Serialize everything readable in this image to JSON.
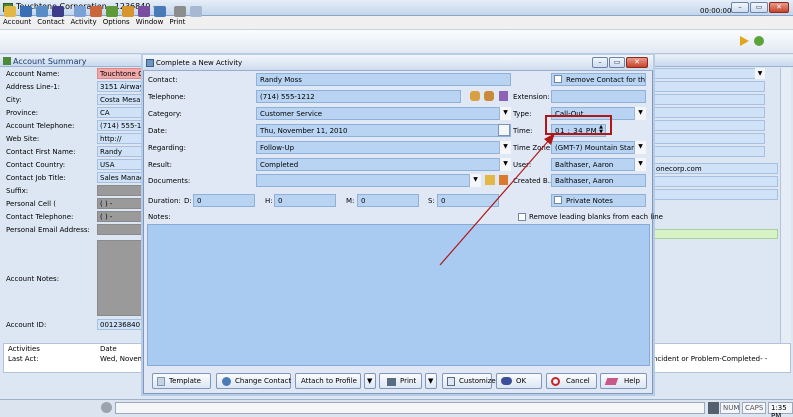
{
  "window": {
    "title": "Touchtone Corporation - 1236840 -",
    "minimize": "–",
    "restore": "▭",
    "close": "✕"
  },
  "menu": [
    "Account",
    "Contact",
    "Activity",
    "Options",
    "Window",
    "Print"
  ],
  "toolbar": {
    "timer": "00:00:00"
  },
  "panel": {
    "title": "Account Summary"
  },
  "account": {
    "fields": [
      {
        "label": "Account Name:",
        "value": "Touchtone Co"
      },
      {
        "label": "Address Line-1:",
        "value": "3151 Airway A"
      },
      {
        "label": "City:",
        "value": "Costa Mesa"
      },
      {
        "label": "Province:",
        "value": "CA"
      },
      {
        "label": "Account Telephone:",
        "value": "(714) 555-12"
      },
      {
        "label": "Web Site:",
        "value": "http://"
      },
      {
        "label": "Contact First Name:",
        "value": "Randy"
      },
      {
        "label": "Contact Country:",
        "value": "USA"
      },
      {
        "label": "Contact Job Title:",
        "value": "Sales Manage"
      },
      {
        "label": "Suffix:",
        "value": ""
      },
      {
        "label": "Personal Cell (",
        "value": "(   )   -"
      },
      {
        "label": "Contact Telephone:",
        "value": "(   )   -"
      },
      {
        "label": "Personal Email Address:",
        "value": ""
      }
    ],
    "notes_label": "Account Notes:",
    "id_label": "Account ID:",
    "id_value": "001236840",
    "right_email": "onecorp.com"
  },
  "activities": {
    "tab": "Activities",
    "col_date": "Date",
    "last_act_label": "Last Act:",
    "last_act_value": "Wed, Novembe",
    "right_text": "ncident or Problem-Completed- -"
  },
  "dialog": {
    "title": "Complete a New Activity",
    "contact": {
      "label": "Contact:",
      "value": "Randy Moss"
    },
    "remove_contact": "Remove Contact for th...",
    "telephone": {
      "label": "Telephone:",
      "value": "(714) 555-1212"
    },
    "extension": {
      "label": "Extension:",
      "value": ""
    },
    "category": {
      "label": "Category:",
      "value": "Customer Service"
    },
    "type": {
      "label": "Type:",
      "value": "Call-Out"
    },
    "date": {
      "label": "Date:",
      "value": "Thu, November 11, 2010"
    },
    "time": {
      "label": "Time:",
      "value": "01 : 34   PM"
    },
    "regarding": {
      "label": "Regarding:",
      "value": "Follow-Up"
    },
    "timezone": {
      "label": "Time Zone:",
      "value": "(GMT-7) Mountain Stan..."
    },
    "result": {
      "label": "Result:",
      "value": "Completed"
    },
    "user": {
      "label": "User:",
      "value": "Balthaser, Aaron"
    },
    "documents": {
      "label": "Documents:",
      "value": ""
    },
    "created_by": {
      "label": "Created B...",
      "value": "Balthaser, Aaron"
    },
    "duration": {
      "label": "Duration:",
      "d": "D:",
      "dv": "0",
      "h": "H:",
      "hv": "0",
      "m": "M:",
      "mv": "0",
      "s": "S:",
      "sv": "0"
    },
    "private_notes": "Private Notes",
    "notes_label": "Notes:",
    "remove_blanks": "Remove leading blanks from each line",
    "buttons": {
      "template": "Template",
      "change_contact": "Change Contact",
      "attach_to_profile": "Attach to Profile",
      "print": "Print",
      "customize": "Customize",
      "ok": "OK",
      "cancel": "Cancel",
      "help": "Help"
    }
  },
  "status": {
    "num": "NUM",
    "caps": "CAPS",
    "clock": "1:35 PM"
  }
}
